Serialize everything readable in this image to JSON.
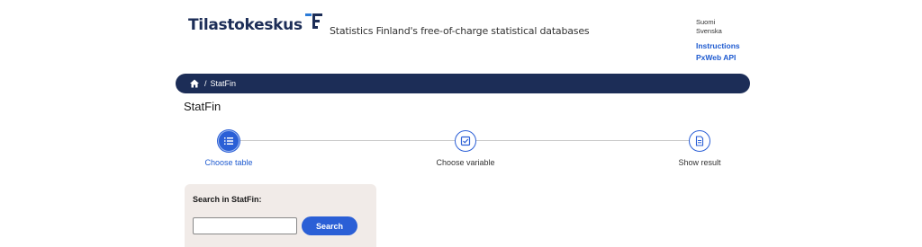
{
  "header": {
    "logo_text": "Tilastokeskus",
    "tagline": "Statistics Finland's free-of-charge statistical databases",
    "languages": [
      "Suomi",
      "Svenska"
    ],
    "links": [
      "Instructions",
      "PxWeb API"
    ]
  },
  "breadcrumb": {
    "separator": "/",
    "items": [
      "StatFin"
    ],
    "home_icon": "home-icon"
  },
  "page_title": "StatFin",
  "stepper": {
    "steps": [
      {
        "label": "Choose table",
        "icon": "list-icon",
        "active": true
      },
      {
        "label": "Choose variable",
        "icon": "checkbox-icon",
        "active": false
      },
      {
        "label": "Show result",
        "icon": "document-icon",
        "active": false
      }
    ]
  },
  "search": {
    "label": "Search in StatFin:",
    "value": "",
    "button_label": "Search"
  },
  "colors": {
    "navy": "#1c2d57",
    "accent_blue": "#2b5fd6",
    "link_blue": "#1f5bd0",
    "search_panel_bg": "#f1ebe8"
  }
}
